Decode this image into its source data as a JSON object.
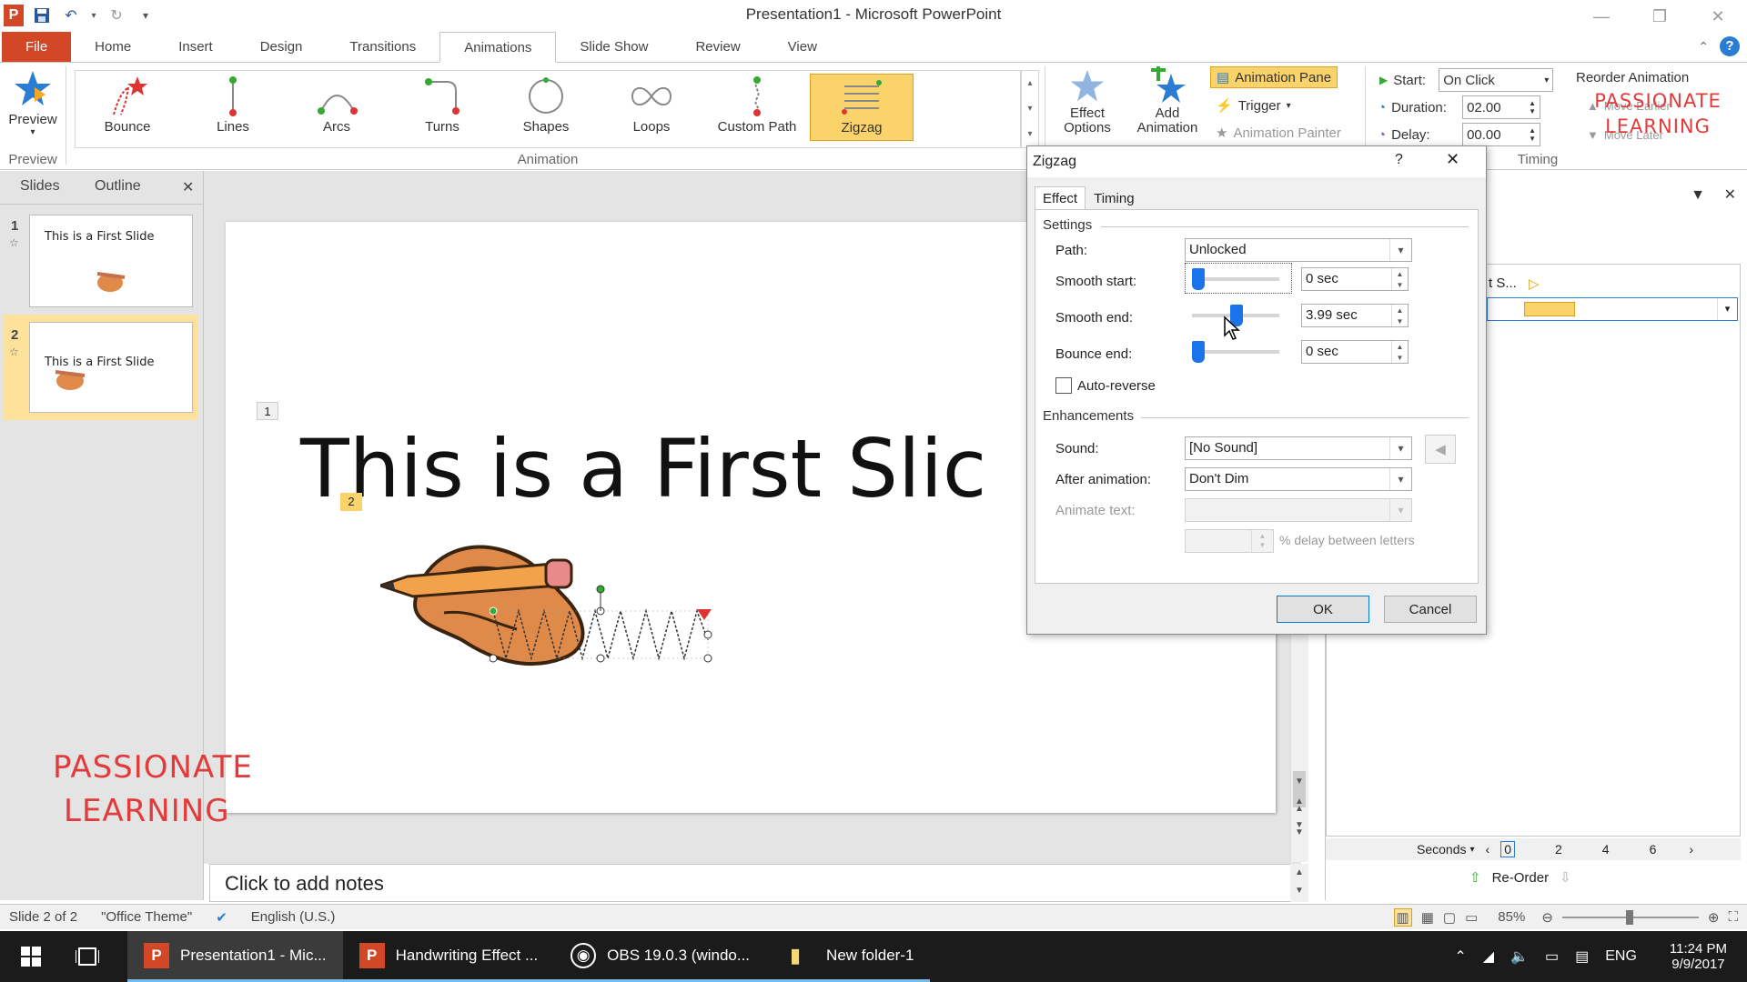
{
  "window": {
    "title": "Presentation1 - Microsoft PowerPoint"
  },
  "ribbon_tabs": [
    "File",
    "Home",
    "Insert",
    "Design",
    "Transitions",
    "Animations",
    "Slide Show",
    "Review",
    "View"
  ],
  "ribbon": {
    "preview_label": "Preview",
    "preview_group": "Preview",
    "animation_group": "Animation",
    "timing_group": "Timing",
    "gallery": [
      "Bounce",
      "Lines",
      "Arcs",
      "Turns",
      "Shapes",
      "Loops",
      "Custom Path",
      "Zigzag"
    ],
    "effect_options": "Effect Options",
    "add_animation": "Add Animation",
    "animation_pane": "Animation Pane",
    "trigger": "Trigger",
    "animation_painter": "Animation Painter",
    "start_label": "Start:",
    "start_value": "On Click",
    "duration_label": "Duration:",
    "duration_value": "02.00",
    "delay_label": "Delay:",
    "delay_value": "00.00",
    "reorder": "Reorder Animation",
    "move_earlier": "Move Earlier",
    "move_later": "Move Later",
    "watermark_small": "PASSIONATE LEARNING"
  },
  "slides_panel": {
    "tab_slides": "Slides",
    "tab_outline": "Outline",
    "thumbs": [
      {
        "num": "1",
        "title": "This is a First Slide"
      },
      {
        "num": "2",
        "title": "This is a First Slide"
      }
    ]
  },
  "slide": {
    "title": "This is a First Slic",
    "tag1": "1",
    "tag2": "2"
  },
  "watermark": {
    "line1": "PASSIONATE",
    "line2": "LEARNING"
  },
  "notes_placeholder": "Click to add notes",
  "anim_pane": {
    "item_text": "t S...",
    "seconds_label": "Seconds",
    "timeline": [
      "0",
      "2",
      "4",
      "6"
    ],
    "reorder_label": "Re-Order"
  },
  "dialog": {
    "title": "Zigzag",
    "help": "?",
    "tabs": [
      "Effect",
      "Timing"
    ],
    "settings_label": "Settings",
    "path_label": "Path:",
    "path_value": "Unlocked",
    "smooth_start_label": "Smooth start:",
    "smooth_start_value": "0 sec",
    "smooth_end_label": "Smooth end:",
    "smooth_end_value": "3.99 sec",
    "bounce_end_label": "Bounce end:",
    "bounce_end_value": "0 sec",
    "auto_reverse_label": "Auto-reverse",
    "enhancements_label": "Enhancements",
    "sound_label": "Sound:",
    "sound_value": "[No Sound]",
    "after_label": "After animation:",
    "after_value": "Don't Dim",
    "animate_text_label": "Animate text:",
    "delay_letters": "% delay between letters",
    "ok": "OK",
    "cancel": "Cancel"
  },
  "statusbar": {
    "slide_info": "Slide 2 of 2",
    "theme": "\"Office Theme\"",
    "language": "English (U.S.)",
    "zoom": "85%"
  },
  "taskbar": {
    "items": [
      "Presentation1 - Mic...",
      "Handwriting Effect ...",
      "OBS 19.0.3 (windo...",
      "New folder-1"
    ],
    "lang": "ENG",
    "time": "11:24 PM",
    "date": "9/9/2017"
  },
  "colors": {
    "accent": "#d24726",
    "selection": "#fbd36b",
    "watermark": "#e23b3b"
  }
}
